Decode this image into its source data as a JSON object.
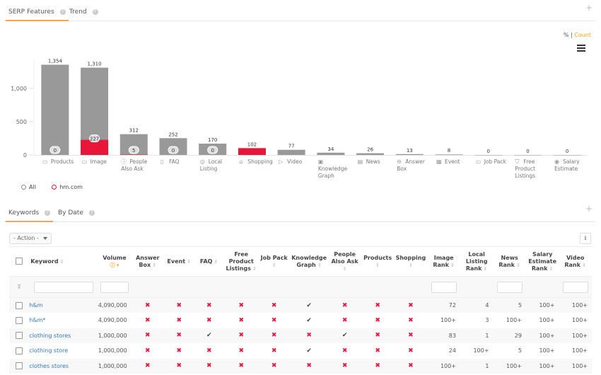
{
  "top_tabs": [
    {
      "label": "SERP Features",
      "active": true
    },
    {
      "label": "Trend",
      "active": false
    }
  ],
  "toggle": {
    "percent": "%",
    "separator": "|",
    "count": "Count",
    "active": "Count"
  },
  "chart_data": {
    "type": "bar",
    "title": "",
    "xlabel": "",
    "ylabel": "",
    "ylim": [
      0,
      1400
    ],
    "yticks": [
      "0",
      "500",
      "1,000"
    ],
    "categories": [
      "Products",
      "Image",
      "People Also Ask",
      "FAQ",
      "Local Listing",
      "Shopping",
      "Video",
      "Knowledge Graph",
      "News",
      "Answer Box",
      "Event",
      "Job Pack",
      "Free Product Listings",
      "Salary Estimate"
    ],
    "category_icons": [
      "products-icon",
      "image-icon",
      "question-icon",
      "faq-icon",
      "location-icon",
      "shopping-bag-icon",
      "video-icon",
      "knowledge-graph-icon",
      "news-icon",
      "answer-box-icon",
      "calendar-icon",
      "briefcase-icon",
      "cart-icon",
      "salary-icon"
    ],
    "series": [
      {
        "name": "All",
        "values": [
          1354,
          1310,
          312,
          252,
          170,
          102,
          77,
          34,
          26,
          13,
          8,
          0,
          0,
          0
        ],
        "color": "#999999"
      },
      {
        "name": "hm.com",
        "values": [
          0,
          227,
          5,
          0,
          0,
          102,
          0,
          0,
          0,
          0,
          0,
          0,
          0,
          0
        ],
        "color": "#e8173a"
      }
    ],
    "labels_total": [
      "1,354",
      "1,310",
      "312",
      "252",
      "170",
      "102",
      "77",
      "34",
      "26",
      "13",
      "8",
      "0",
      "0",
      "0"
    ],
    "labels_domain": [
      "0",
      "227",
      "5",
      "0",
      "0",
      "",
      "",
      "",
      "",
      "",
      "",
      "",
      "",
      ""
    ],
    "legend_position": "bottom-left"
  },
  "legend": [
    {
      "label": "All",
      "color": "#888888"
    },
    {
      "label": "hm.com",
      "color": "#e8173a"
    }
  ],
  "bottom_tabs": [
    {
      "label": "Keywords",
      "active": true
    },
    {
      "label": "By Date",
      "active": false
    }
  ],
  "action_label": "- Action -",
  "table": {
    "columns": [
      "Keyword",
      "Volume",
      "Answer Box",
      "Event",
      "FAQ",
      "Free Product Listings",
      "Job Pack",
      "Knowledge Graph",
      "People Also Ask",
      "Products",
      "Shopping",
      "Image Rank",
      "Local Listing Rank",
      "News Rank",
      "Salary Estimate Rank",
      "Video Rank"
    ],
    "rows": [
      {
        "keyword": "h&m",
        "volume": "4,090,000",
        "features": [
          "x",
          "x",
          "x",
          "x",
          "x",
          "check",
          "x",
          "x",
          "x"
        ],
        "ranks": [
          "72",
          "4",
          "5",
          "100+",
          "100+"
        ]
      },
      {
        "keyword": "h&m*",
        "volume": "4,090,000",
        "features": [
          "x",
          "x",
          "x",
          "x",
          "x",
          "check",
          "x",
          "x",
          "x"
        ],
        "ranks": [
          "100+",
          "3",
          "100+",
          "100+",
          "100+"
        ]
      },
      {
        "keyword": "clothing stores",
        "volume": "1,000,000",
        "features": [
          "x",
          "x",
          "check",
          "x",
          "x",
          "x",
          "check",
          "x",
          "x"
        ],
        "ranks": [
          "83",
          "1",
          "29",
          "100+",
          "100+"
        ]
      },
      {
        "keyword": "clothing store",
        "volume": "1,000,000",
        "features": [
          "x",
          "x",
          "x",
          "x",
          "x",
          "check",
          "x",
          "x",
          "x"
        ],
        "ranks": [
          "24",
          "100+",
          "5",
          "100+",
          "100+"
        ]
      },
      {
        "keyword": "clothes stores",
        "volume": "1,000,000",
        "features": [
          "x",
          "x",
          "x",
          "x",
          "x",
          "x",
          "x",
          "x",
          "x"
        ],
        "ranks": [
          "100+",
          "1",
          "100+",
          "100+",
          "100+"
        ]
      }
    ]
  }
}
